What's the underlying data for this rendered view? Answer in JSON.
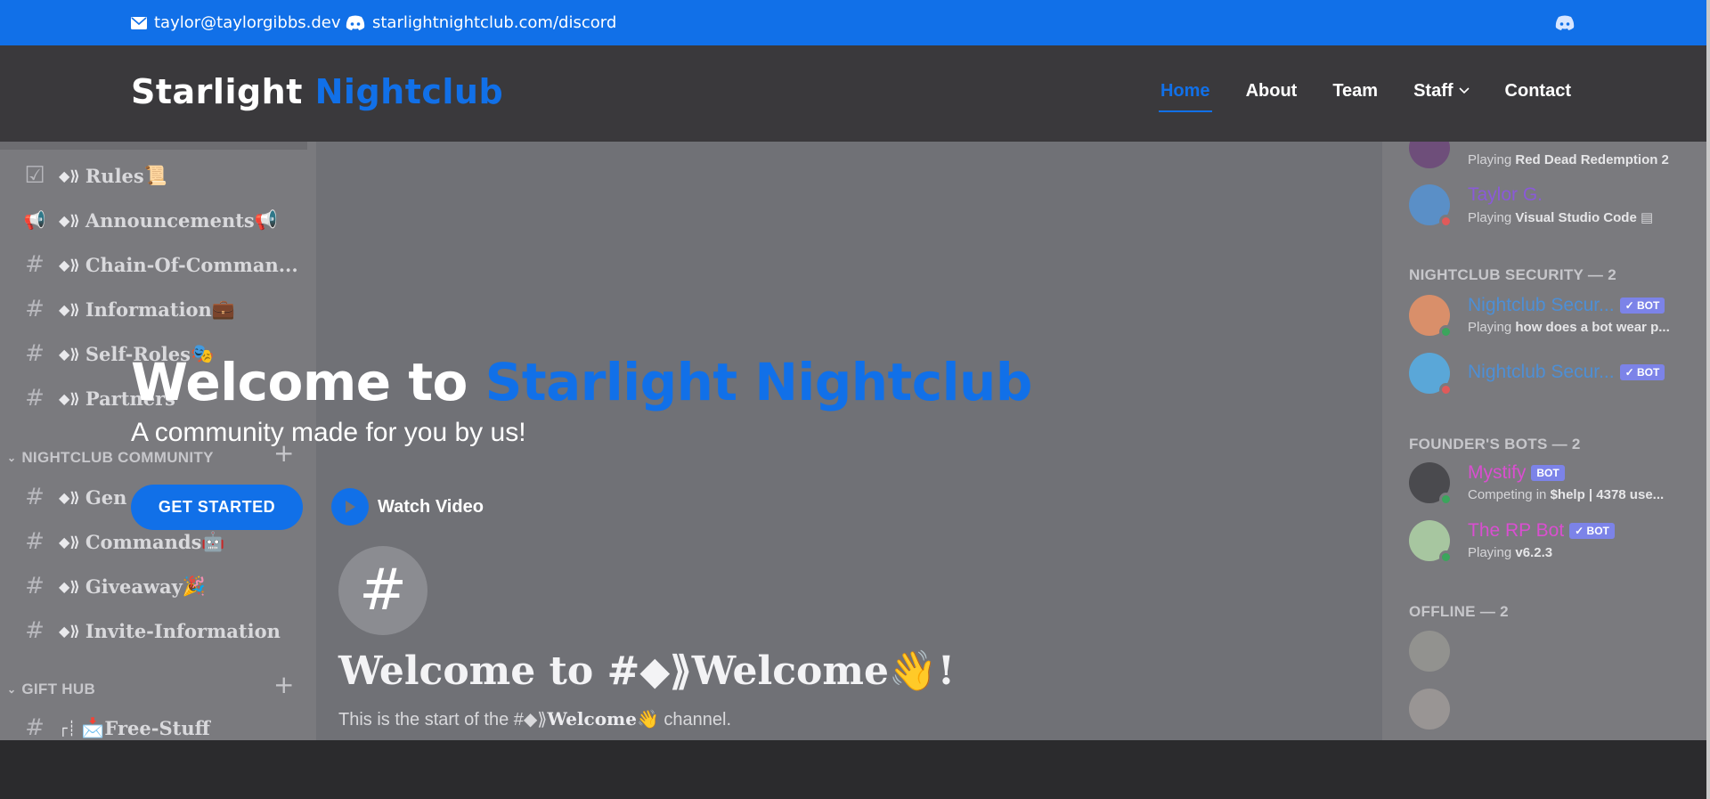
{
  "topbar": {
    "email": "taylor@taylorgibbs.dev",
    "discord_link": "starlightnightclub.com/discord",
    "icons": [
      "envelope-icon",
      "discord-icon",
      "discord-icon"
    ]
  },
  "brand": {
    "name_part1": "Starlight",
    "name_part2": "Nightclub"
  },
  "nav": {
    "items": [
      {
        "label": "Home",
        "active": true
      },
      {
        "label": "About"
      },
      {
        "label": "Team"
      },
      {
        "label": "Staff",
        "has_dropdown": true
      },
      {
        "label": "Contact"
      }
    ]
  },
  "hero": {
    "title_part1": "Welcome to",
    "title_part2": "Starlight Nightclub",
    "subtitle": "A community made for you by us!",
    "cta_label": "GET STARTED",
    "watch_label": "Watch Video"
  },
  "discord_bg": {
    "channels": [
      {
        "name": "Rules",
        "emoji": "📜",
        "icon": "checkbox-icon"
      },
      {
        "name": "Announcements",
        "emoji": "📢",
        "icon": "megaphone-icon"
      },
      {
        "name": "Chain-Of-Comman...",
        "emoji": "",
        "icon": "hash-icon"
      },
      {
        "name": "Information",
        "emoji": "💼",
        "icon": "hash-icon"
      },
      {
        "name": "Self-Roles",
        "emoji": "🎭",
        "icon": "hash-icon"
      },
      {
        "name": "Partners",
        "emoji": "",
        "icon": "hash-icon"
      }
    ],
    "category_community": "NIGHTCLUB COMMUNITY",
    "community_channels": [
      {
        "name": "Gen",
        "emoji": ""
      },
      {
        "name": "Commands",
        "emoji": "🤖"
      },
      {
        "name": "Giveaway",
        "emoji": "🎉"
      },
      {
        "name": "Invite-Information",
        "emoji": ""
      }
    ],
    "category_gift": "GIFT HUB",
    "gift_channels": [
      {
        "name": "Free-Stuff",
        "prefix": "┌┊",
        "emoji": "📩"
      }
    ],
    "channel_header": {
      "welcome": "Welcome to #◆⟫Welcome👋!",
      "start_text_1": "This is the start of the #◆⟫",
      "start_text_bold": "Welcome",
      "start_text_2": "👋 channel."
    },
    "members": {
      "top": [
        {
          "name": "",
          "activity_prefix": "Playing",
          "activity": "Red Dead Redemption 2"
        },
        {
          "name": "Taylor G.",
          "activity_prefix": "Playing",
          "activity": "Visual Studio Code"
        }
      ],
      "security_label": "NIGHTCLUB SECURITY — 2",
      "security": [
        {
          "name": "Nightclub Secur...",
          "badge": "✓ BOT",
          "activity_prefix": "Playing",
          "activity": "how does a bot wear p..."
        },
        {
          "name": "Nightclub Secur...",
          "badge": "✓ BOT"
        }
      ],
      "founder_label": "FOUNDER'S BOTS — 2",
      "founder": [
        {
          "name": "Mystify",
          "badge": "BOT",
          "activity_prefix": "Competing in",
          "activity": "$help | 4378 use..."
        },
        {
          "name": "The RP Bot",
          "badge": "✓ BOT",
          "activity_prefix": "Playing",
          "activity": "v6.2.3"
        }
      ],
      "offline_label": "OFFLINE — 2"
    }
  },
  "colors": {
    "accent": "#1170e8",
    "header_bg": "#3a393c",
    "overlay": "#707176"
  }
}
